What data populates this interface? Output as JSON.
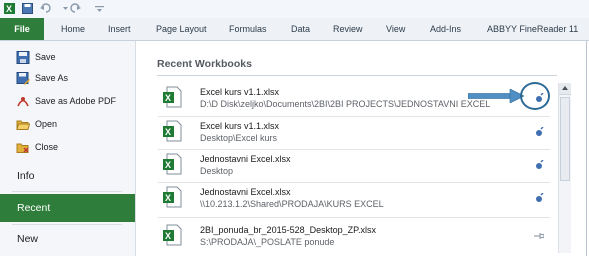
{
  "tabs": {
    "file": "File",
    "items": [
      "Home",
      "Insert",
      "Page Layout",
      "Formulas",
      "Data",
      "Review",
      "View",
      "Add-Ins",
      "ABBYY FineReader 11"
    ]
  },
  "nav": {
    "save": "Save",
    "save_as": "Save As",
    "save_pdf": "Save as Adobe PDF",
    "open": "Open",
    "close": "Close",
    "info": "Info",
    "recent": "Recent",
    "new": "New"
  },
  "main": {
    "heading": "Recent Workbooks",
    "files": [
      {
        "name": "Excel kurs v1.1.xlsx",
        "path": "D:\\D Disk\\zeljko\\Documents\\2BI\\2BI PROJECTS\\JEDNOSTAVNI EXCEL"
      },
      {
        "name": "Excel kurs v1.1.xlsx",
        "path": "Desktop\\Excel kurs"
      },
      {
        "name": "Jednostavni Excel.xlsx",
        "path": "Desktop"
      },
      {
        "name": "Jednostavni Excel.xlsx",
        "path": "\\\\10.213.1.2\\Shared\\PRODAJA\\KURS EXCEL"
      },
      {
        "name": "2BI_ponuda_br_2015-528_Desktop_ZP.xlsx",
        "path": "S:\\PRODAJA\\_POSLATE ponude"
      }
    ]
  },
  "colors": {
    "accent": "#2f7d3a",
    "callout": "#2d6a96"
  }
}
